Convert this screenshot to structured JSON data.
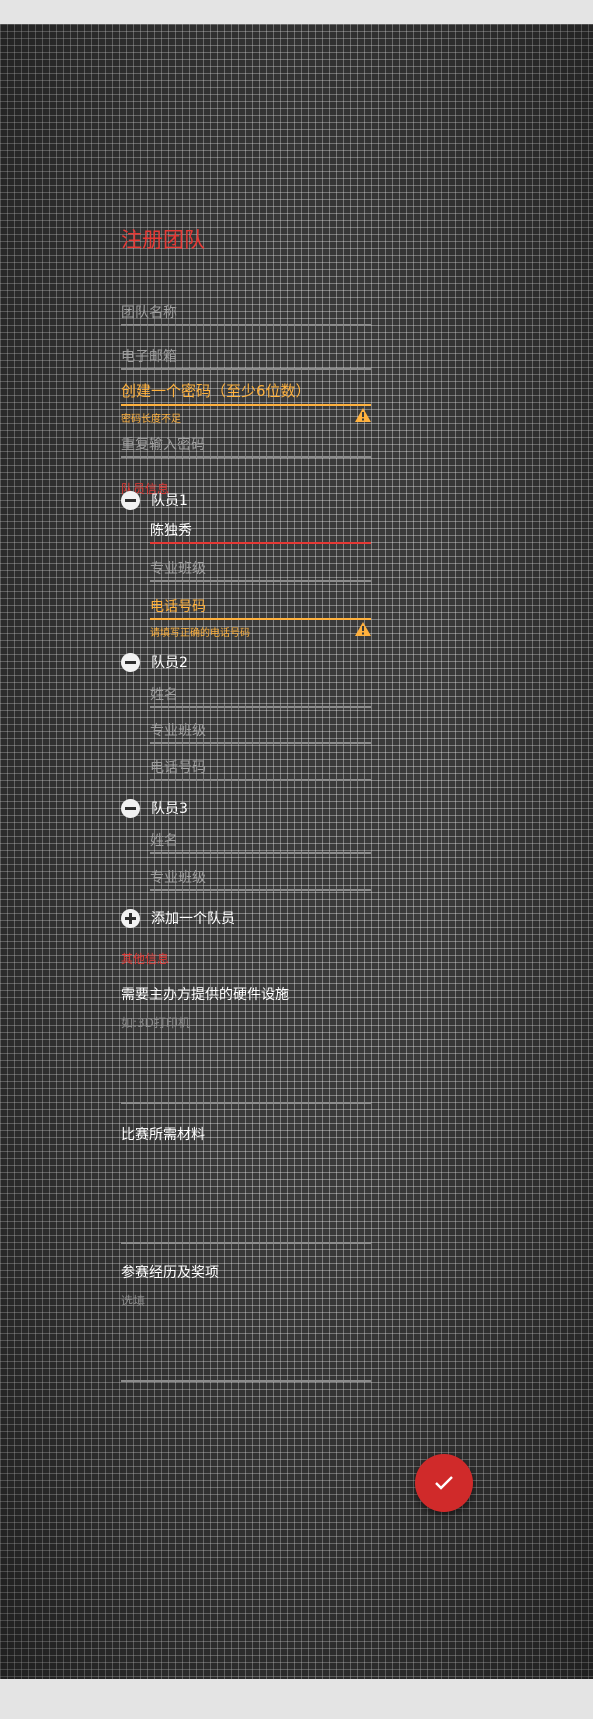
{
  "title": "注册团队",
  "team_name": {
    "placeholder": "团队名称"
  },
  "email": {
    "placeholder": "电子邮箱"
  },
  "password": {
    "label": "创建一个密码（至少6位数）",
    "error": "密码长度不足"
  },
  "confirm_password": {
    "placeholder": "重复输入密码"
  },
  "members_section": "队员信息",
  "members": [
    {
      "label": "队员1",
      "name_value": "陈独秀",
      "major_placeholder": "专业班级",
      "phone_label": "电话号码",
      "phone_error": "请填写正确的电话号码"
    },
    {
      "label": "队员2",
      "name_placeholder": "姓名",
      "major_placeholder": "专业班级",
      "phone_placeholder": "电话号码"
    },
    {
      "label": "队员3",
      "name_placeholder": "姓名",
      "major_placeholder": "专业班级"
    }
  ],
  "add_member": "添加一个队员",
  "other_section": "其他信息",
  "hardware": {
    "label": "需要主办方提供的硬件设施",
    "placeholder": "如:3D打印机"
  },
  "materials": {
    "label": "比赛所需材料"
  },
  "experience": {
    "label": "参赛经历及奖项",
    "placeholder": "选填"
  },
  "colors": {
    "accent": "#e53935",
    "warning": "#ffb13d",
    "fab": "#d02a2a"
  },
  "icons": {
    "remove": "minus-circle-icon",
    "add": "plus-circle-icon",
    "warning": "warning-triangle-icon",
    "submit": "check-icon"
  }
}
